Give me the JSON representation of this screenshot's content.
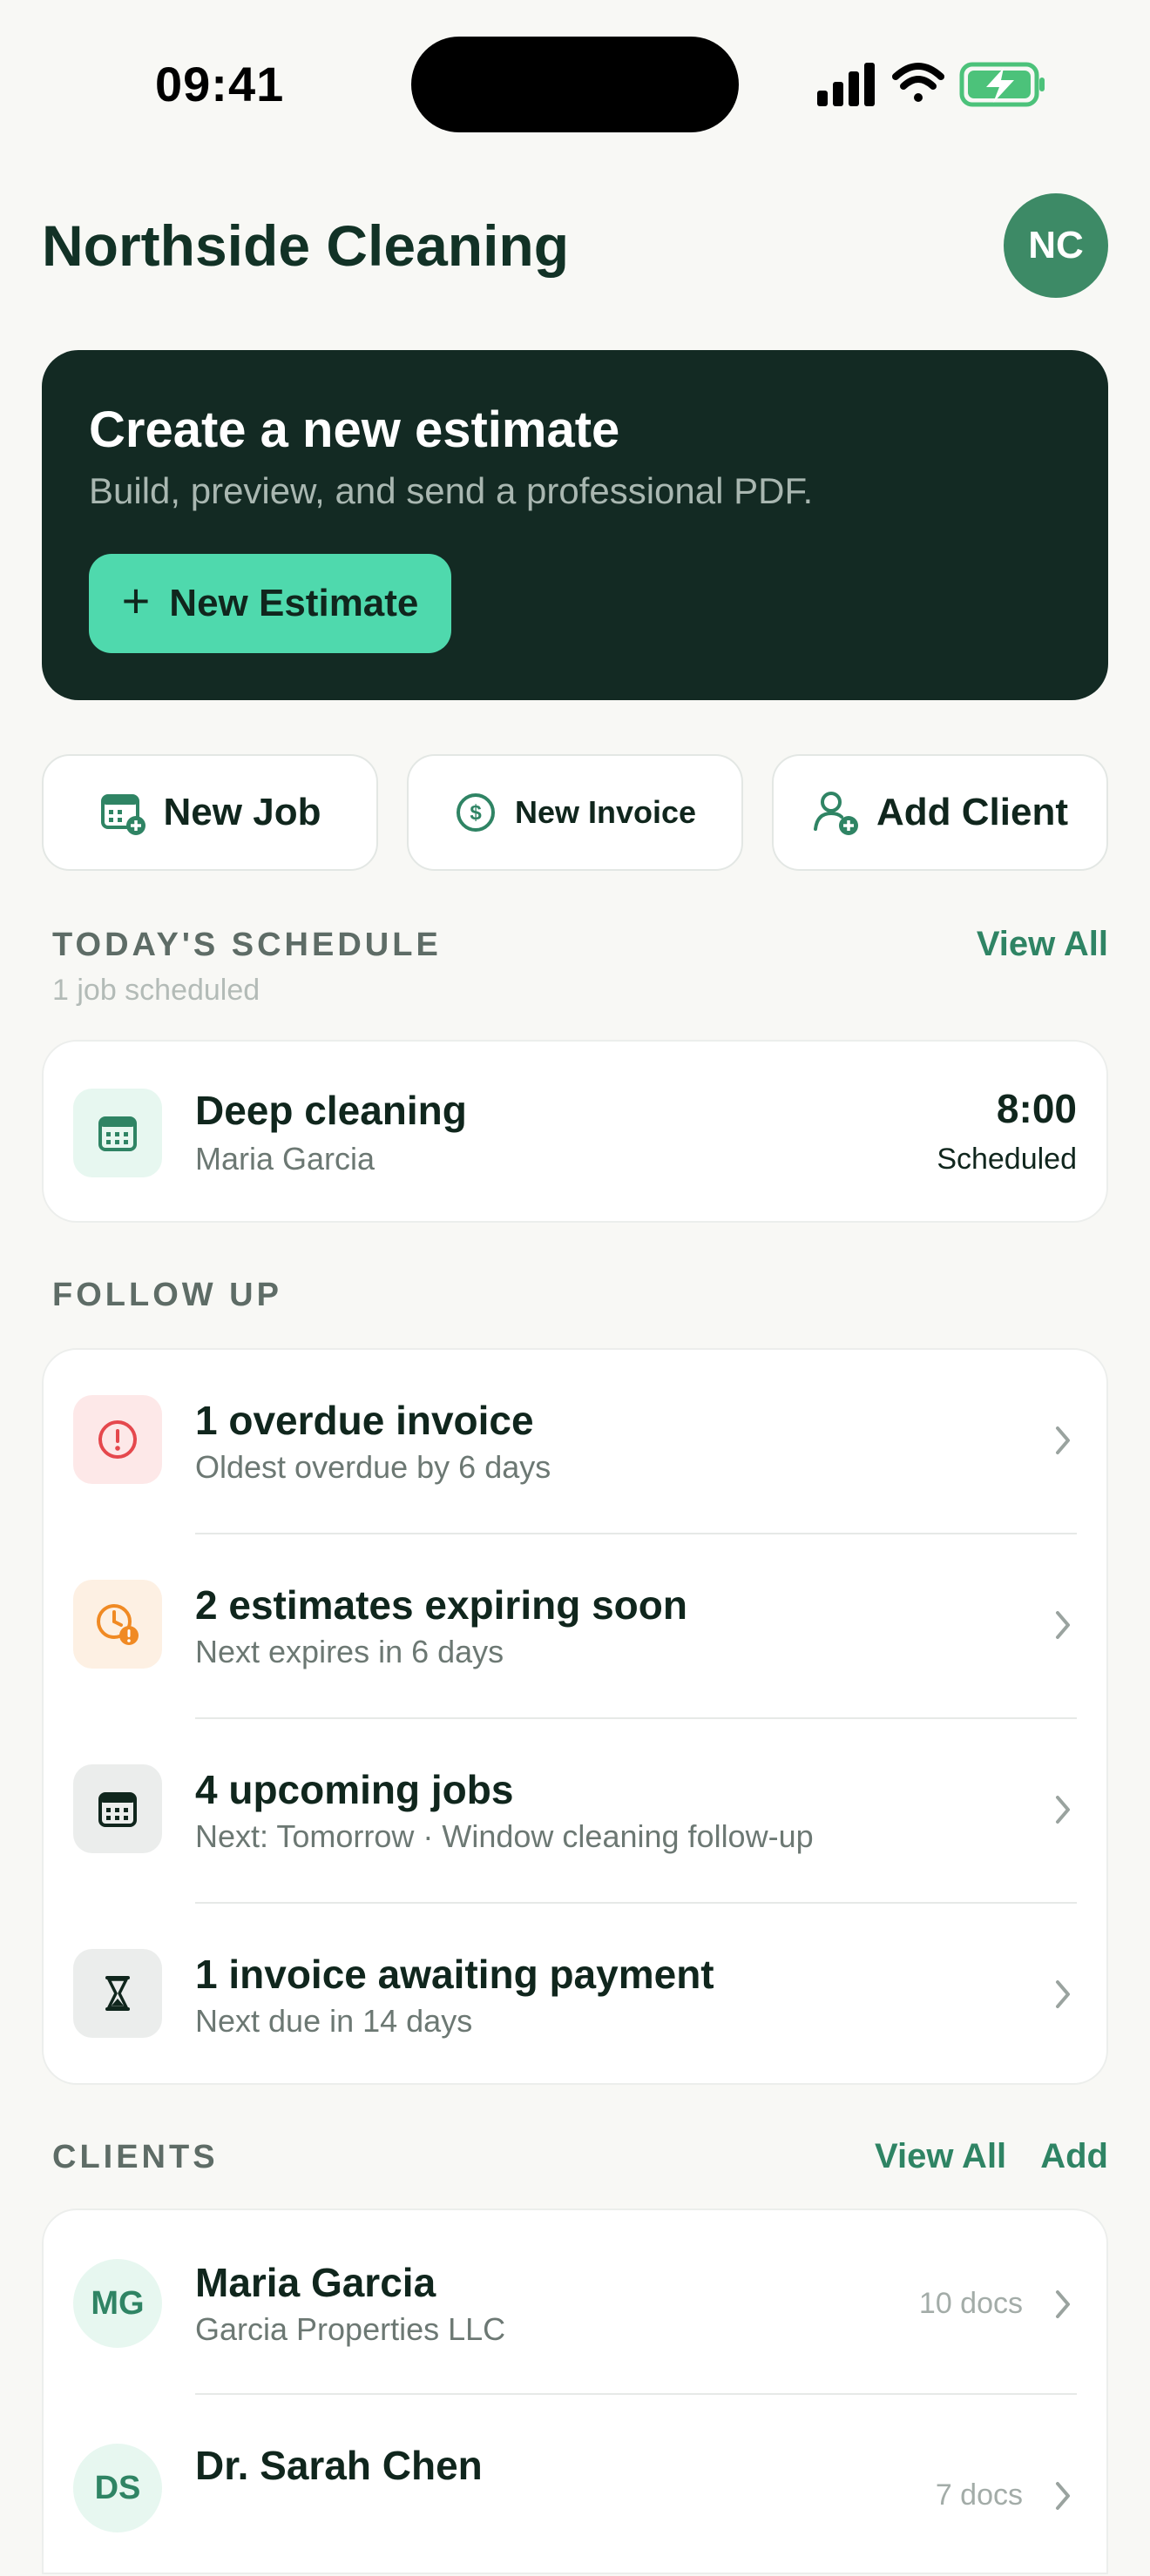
{
  "status_bar": {
    "time": "09:41"
  },
  "header": {
    "title": "Northside Cleaning",
    "avatar_initials": "NC"
  },
  "hero": {
    "title": "Create a new estimate",
    "subtitle": "Build, preview, and send a professional PDF.",
    "button_label": "New Estimate",
    "button_icon": "plus-icon"
  },
  "quick_actions": [
    {
      "label": "New Job",
      "icon": "calendar-add-icon"
    },
    {
      "label": "New Invoice",
      "icon": "dollar-circle-icon"
    },
    {
      "label": "Add Client",
      "icon": "user-add-icon"
    }
  ],
  "schedule": {
    "title": "TODAY'S SCHEDULE",
    "subtitle": "1 job scheduled",
    "view_all": "View All",
    "job": {
      "title": "Deep cleaning",
      "client": "Maria Garcia",
      "time": "8:00",
      "status": "Scheduled",
      "icon": "calendar-icon"
    }
  },
  "follow_up": {
    "title": "FOLLOW UP",
    "items": [
      {
        "title": "1 overdue invoice",
        "subtitle": "Oldest overdue by 6 days",
        "icon": "alert-circle-icon"
      },
      {
        "title": "2 estimates expiring soon",
        "subtitle": "Next expires in 6 days",
        "icon": "clock-alert-icon"
      },
      {
        "title": "4 upcoming jobs",
        "subtitle": "Next: Tomorrow · Window cleaning follow-up",
        "icon": "calendar-icon"
      },
      {
        "title": "1 invoice awaiting payment",
        "subtitle": "Next due in 14 days",
        "icon": "hourglass-icon"
      }
    ]
  },
  "clients": {
    "title": "CLIENTS",
    "view_all": "View All",
    "add": "Add",
    "items": [
      {
        "initials": "MG",
        "name": "Maria Garcia",
        "company": "Garcia Properties LLC",
        "docs": "10 docs"
      },
      {
        "initials": "DS",
        "name": "Dr. Sarah Chen",
        "company": "",
        "docs": "7 docs"
      }
    ]
  },
  "colors": {
    "accent": "#2f8464",
    "hero_bg": "#132a23",
    "hero_button": "#4fd9ad",
    "avatar_bg": "#3d8a66",
    "danger": "#e5484d",
    "warning": "#f08a24"
  }
}
